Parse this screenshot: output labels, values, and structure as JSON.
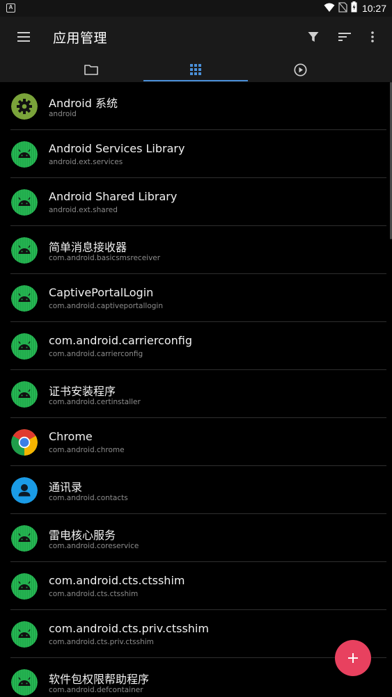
{
  "status_bar": {
    "time": "10:27",
    "icons": [
      "app-notification-icon",
      "wifi-icon",
      "no-sim-icon",
      "battery-icon"
    ]
  },
  "app_bar": {
    "title": "应用管理",
    "actions": [
      "filter-icon",
      "sort-icon",
      "more-vert-icon"
    ]
  },
  "tabs": [
    {
      "icon": "folder-icon",
      "selected": false
    },
    {
      "icon": "apps-grid-icon",
      "selected": true
    },
    {
      "icon": "play-circle-icon",
      "selected": false
    }
  ],
  "colors": {
    "accent": "#4a90d9",
    "fab": "#e8415f",
    "android_green": "#1fa84a"
  },
  "apps": [
    {
      "name": "Android 系统",
      "package": "android",
      "icon": "settings-gear-icon"
    },
    {
      "name": "Android Services Library",
      "package": "android.ext.services",
      "icon": "android-icon"
    },
    {
      "name": "Android Shared Library",
      "package": "android.ext.shared",
      "icon": "android-icon"
    },
    {
      "name": "简单消息接收器",
      "package": "com.android.basicsmsreceiver",
      "icon": "android-icon"
    },
    {
      "name": "CaptivePortalLogin",
      "package": "com.android.captiveportallogin",
      "icon": "android-icon"
    },
    {
      "name": "com.android.carrierconfig",
      "package": "com.android.carrierconfig",
      "icon": "android-icon"
    },
    {
      "name": "证书安装程序",
      "package": "com.android.certinstaller",
      "icon": "android-icon"
    },
    {
      "name": "Chrome",
      "package": "com.android.chrome",
      "icon": "chrome-icon"
    },
    {
      "name": "通讯录",
      "package": "com.android.contacts",
      "icon": "contacts-icon"
    },
    {
      "name": "雷电核心服务",
      "package": "com.android.coreservice",
      "icon": "android-icon"
    },
    {
      "name": "com.android.cts.ctsshim",
      "package": "com.android.cts.ctsshim",
      "icon": "android-icon"
    },
    {
      "name": "com.android.cts.priv.ctsshim",
      "package": "com.android.cts.priv.ctsshim",
      "icon": "android-icon"
    },
    {
      "name": "软件包权限帮助程序",
      "package": "com.android.defcontainer",
      "icon": "android-icon"
    }
  ],
  "fab": {
    "icon": "plus-icon"
  }
}
